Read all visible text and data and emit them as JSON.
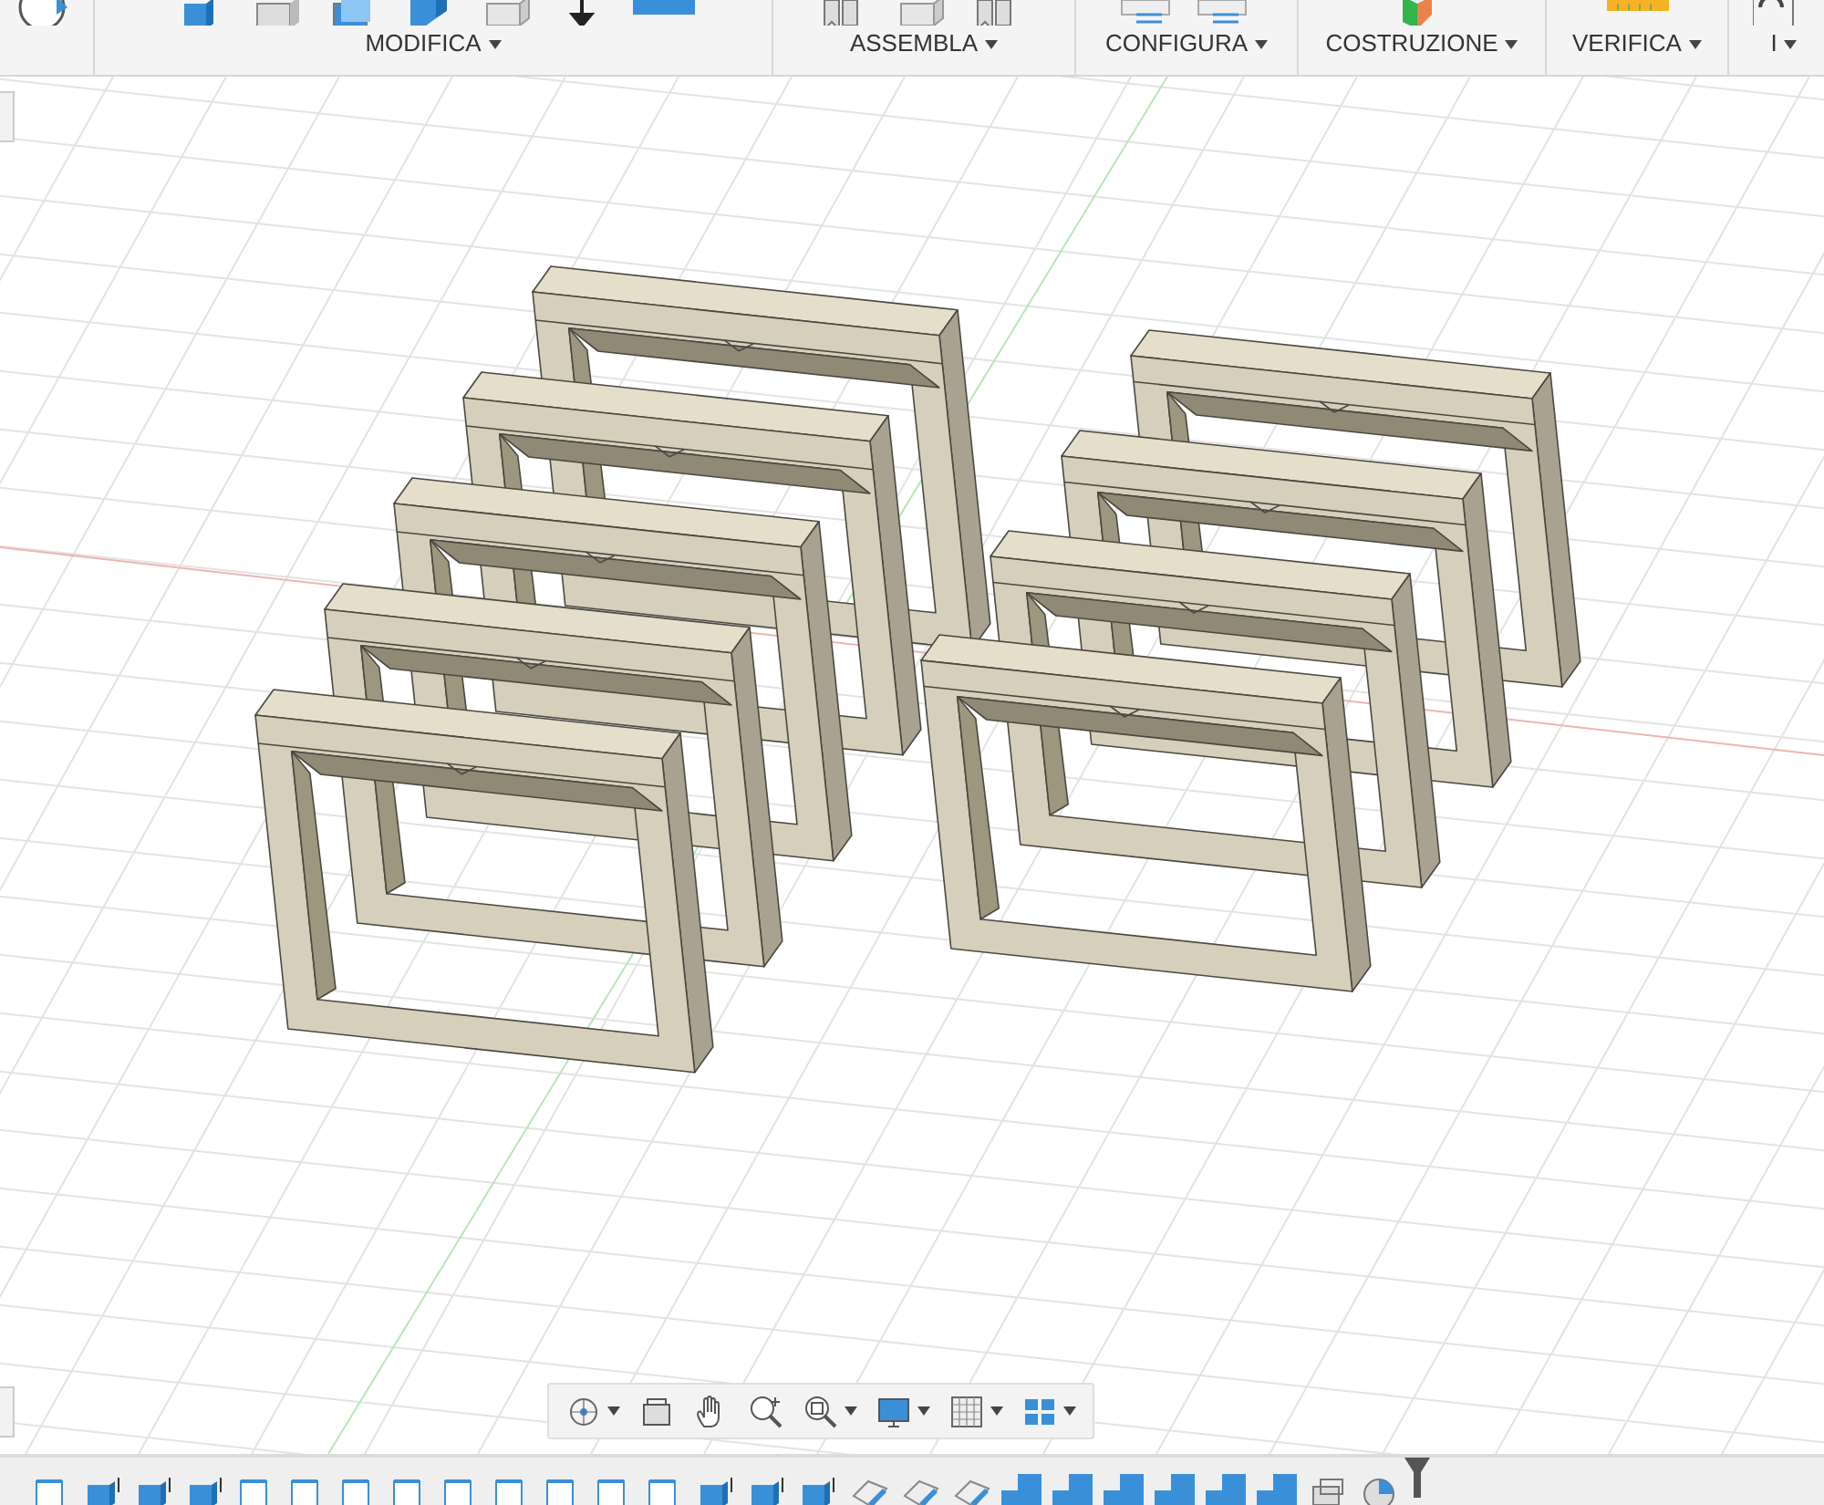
{
  "toolbar": {
    "groups": [
      {
        "tools": [
          {
            "kind": "sphere"
          }
        ]
      },
      {
        "label": "MODIFICA",
        "tools": [
          {
            "kind": "press"
          },
          {
            "kind": "fillet"
          },
          {
            "kind": "shell"
          },
          {
            "kind": "combine"
          },
          {
            "kind": "box"
          },
          {
            "kind": "move"
          },
          {
            "kind": "plane"
          }
        ]
      },
      {
        "label": "ASSEMBLA",
        "tools": [
          {
            "kind": "joint"
          },
          {
            "kind": "box"
          },
          {
            "kind": "joint"
          }
        ]
      },
      {
        "label": "CONFIGURA",
        "tools": [
          {
            "kind": "table"
          },
          {
            "kind": "table"
          }
        ]
      },
      {
        "label": "COSTRUZIONE",
        "tools": [
          {
            "kind": "construct"
          }
        ]
      },
      {
        "label": "VERIFICA",
        "tools": [
          {
            "kind": "measure"
          }
        ]
      },
      {
        "label": "I",
        "tools": [
          {
            "kind": "link"
          }
        ]
      }
    ]
  },
  "nav_toolbar": {
    "items": [
      {
        "kind": "orbit",
        "dropdown": true
      },
      {
        "kind": "look",
        "dropdown": false
      },
      {
        "kind": "pan",
        "dropdown": false
      },
      {
        "kind": "zoom",
        "dropdown": false
      },
      {
        "kind": "fit",
        "dropdown": true
      },
      {
        "kind": "display",
        "dropdown": true
      },
      {
        "kind": "grid",
        "dropdown": true
      },
      {
        "kind": "viewports",
        "dropdown": true
      }
    ]
  },
  "timeline": {
    "items": [
      {
        "kind": "sketch"
      },
      {
        "kind": "extrude"
      },
      {
        "kind": "extrude"
      },
      {
        "kind": "extrude"
      },
      {
        "kind": "sketch"
      },
      {
        "kind": "sketch"
      },
      {
        "kind": "sketch"
      },
      {
        "kind": "sketch"
      },
      {
        "kind": "sketch"
      },
      {
        "kind": "sketch"
      },
      {
        "kind": "sketch"
      },
      {
        "kind": "sketch"
      },
      {
        "kind": "sketch"
      },
      {
        "kind": "extrude"
      },
      {
        "kind": "extrude"
      },
      {
        "kind": "extrude"
      },
      {
        "kind": "split"
      },
      {
        "kind": "split"
      },
      {
        "kind": "split"
      },
      {
        "kind": "step"
      },
      {
        "kind": "step"
      },
      {
        "kind": "step"
      },
      {
        "kind": "step"
      },
      {
        "kind": "step"
      },
      {
        "kind": "step"
      },
      {
        "kind": "combine"
      },
      {
        "kind": "ring"
      }
    ]
  }
}
